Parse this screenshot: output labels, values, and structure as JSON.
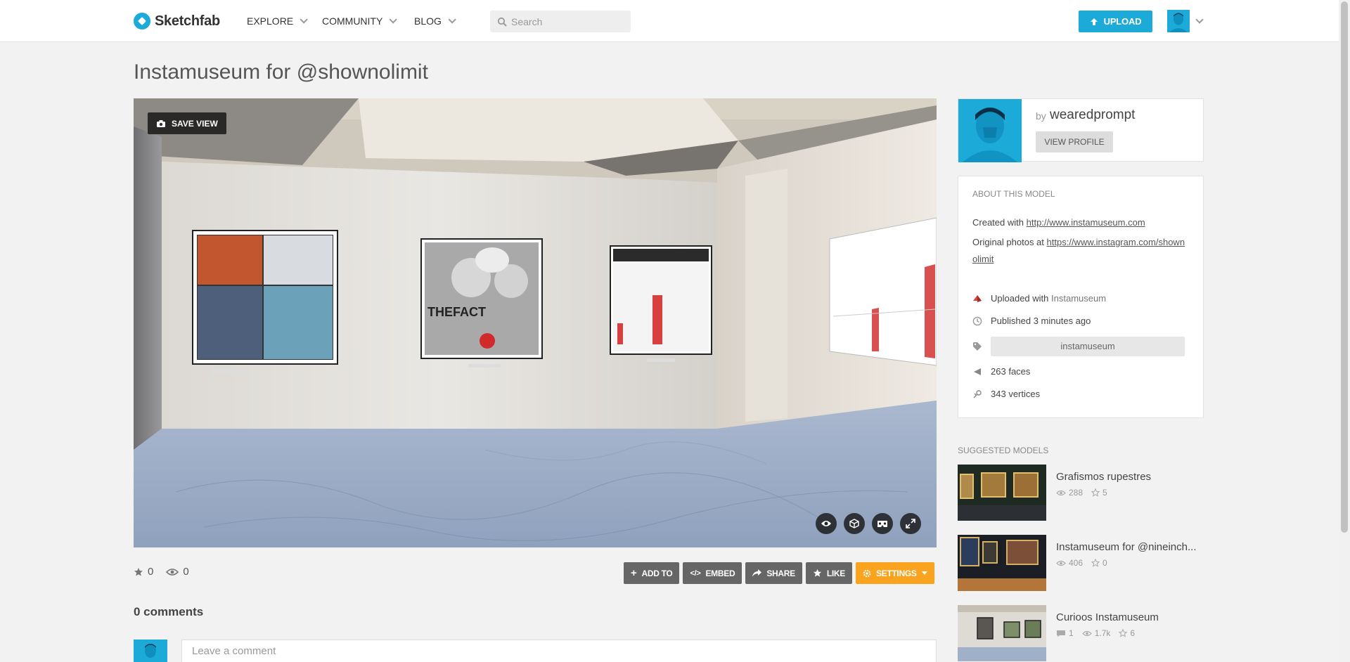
{
  "header": {
    "brand": "Sketchfab",
    "nav": [
      {
        "label": "EXPLORE"
      },
      {
        "label": "COMMUNITY"
      },
      {
        "label": "BLOG"
      }
    ],
    "search_placeholder": "Search",
    "upload_label": "UPLOAD"
  },
  "model": {
    "title": "Instamuseum for @shownolimit",
    "save_view_label": "SAVE VIEW",
    "scene_labels": {
      "poster_text": "THEFACT"
    },
    "stars": "0",
    "views": "0",
    "actions": {
      "add_to": "ADD TO",
      "embed": "EMBED",
      "share": "SHARE",
      "like": "LIKE",
      "settings": "SETTINGS"
    }
  },
  "comments": {
    "heading": "0 comments",
    "placeholder": "Leave a comment"
  },
  "author": {
    "by": "by",
    "name": "wearedprompt",
    "view_profile": "VIEW PROFILE"
  },
  "about": {
    "heading": "ABOUT THIS MODEL",
    "created_prefix": "Created with",
    "created_link": "http://www.instamuseum.com",
    "photos_prefix": "Original photos at",
    "photos_link": "https://www.instagram.com/shownolimit",
    "uploaded_prefix": "Uploaded with",
    "uploaded_app": "Instamuseum",
    "published": "Published 3 minutes ago",
    "tag": "instamuseum",
    "faces_count": "263",
    "faces_label": "faces",
    "vertices_count": "343",
    "vertices_label": "vertices"
  },
  "suggested": {
    "heading": "SUGGESTED MODELS",
    "items": [
      {
        "title": "Grafismos rupestres",
        "comments": null,
        "views": "288",
        "likes": "5"
      },
      {
        "title": "Instamuseum for @nineinch...",
        "comments": null,
        "views": "406",
        "likes": "0"
      },
      {
        "title": "Curioos Instamuseum",
        "comments": "1",
        "views": "1.7k",
        "likes": "6"
      }
    ]
  },
  "colors": {
    "accent": "#1caad9",
    "settings": "#f9a31f",
    "action": "#666666"
  }
}
